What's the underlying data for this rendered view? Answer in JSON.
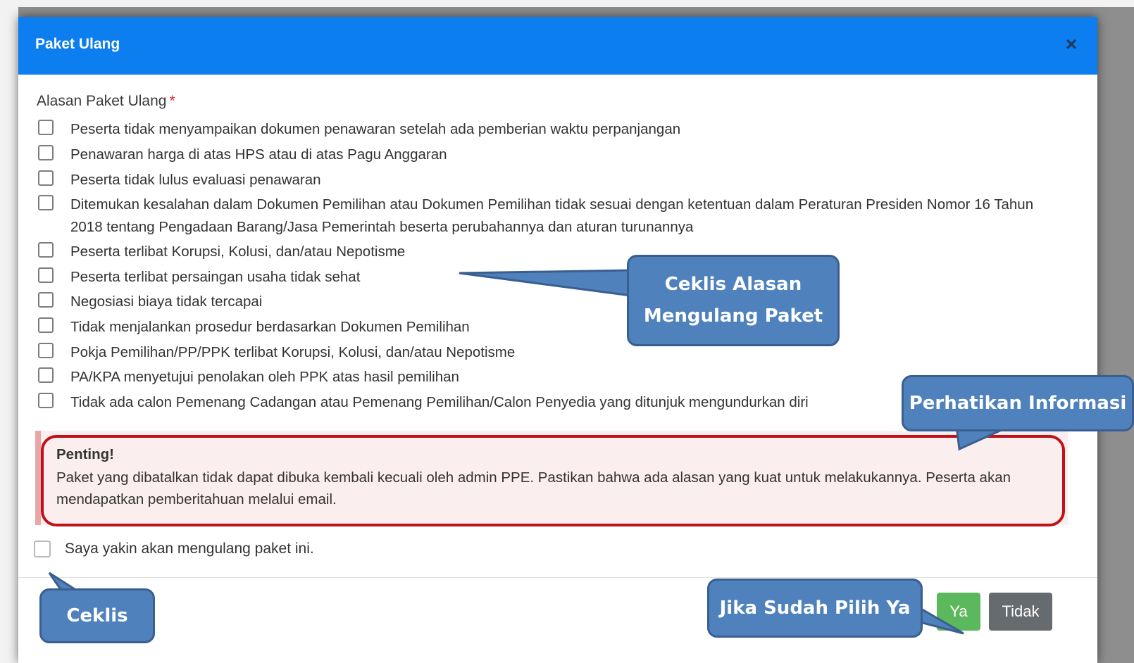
{
  "modal": {
    "title": "Paket Ulang",
    "close_symbol": "×",
    "field_label": "Alasan Paket Ulang",
    "required_marker": "*",
    "options": [
      "Peserta tidak menyampaikan dokumen penawaran setelah ada pemberian waktu perpanjangan",
      "Penawaran harga di atas HPS atau di atas Pagu Anggaran",
      "Peserta tidak lulus evaluasi penawaran",
      "Ditemukan kesalahan dalam Dokumen Pemilihan atau Dokumen Pemilihan tidak sesuai dengan ketentuan dalam Peraturan Presiden Nomor 16 Tahun 2018 tentang Pengadaan Barang/Jasa Pemerintah beserta perubahannya dan aturan turunannya",
      "Peserta terlibat Korupsi, Kolusi, dan/atau Nepotisme",
      "Peserta terlibat persaingan usaha tidak sehat",
      "Negosiasi biaya tidak tercapai",
      "Tidak menjalankan prosedur berdasarkan Dokumen Pemilihan",
      "Pokja Pemilihan/PP/PPK terlibat Korupsi, Kolusi, dan/atau Nepotisme",
      "PA/KPA menyetujui penolakan oleh PPK atas hasil pemilihan",
      "Tidak ada calon Pemenang Cadangan atau Pemenang Pemilihan/Calon Penyedia yang ditunjuk mengundurkan diri"
    ],
    "alert_title": "Penting!",
    "alert_body": "Paket yang dibatalkan tidak dapat dibuka kembali kecuali oleh admin PPE. Pastikan bahwa ada alasan yang kuat untuk melakukannya. Peserta akan mendapatkan pemberitahuan melalui email.",
    "confirm_label": "Saya yakin akan mengulang paket ini.",
    "yes_label": "Ya",
    "no_label": "Tidak"
  },
  "callouts": {
    "reasons": [
      "Ceklis Alasan",
      "Mengulang Paket"
    ],
    "info": "Perhatikan Informasi",
    "check": "Ceklis",
    "yes": "Jika Sudah Pilih Ya"
  },
  "colors": {
    "header": "#0d7ef0",
    "callout": "#4f81bd",
    "alert_border": "#c0101a",
    "yes_button": "#5cb85c",
    "no_button": "#666b70"
  }
}
